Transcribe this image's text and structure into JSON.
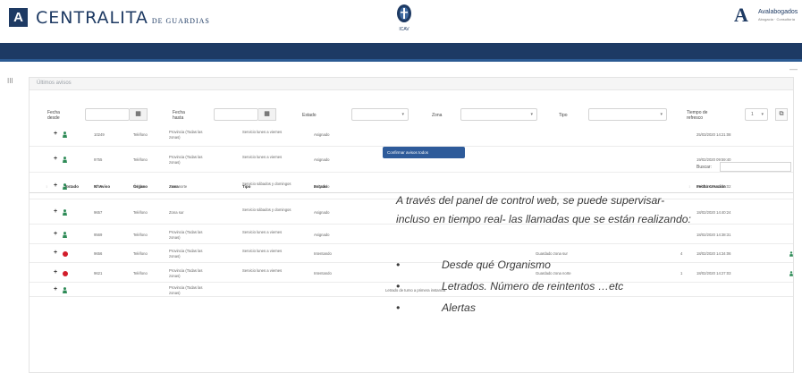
{
  "header": {
    "logo_letter": "A",
    "brand_main": "CENTRALITA",
    "brand_sub": "DE GUARDIAS",
    "emblem_text": "ICAV",
    "right_logo_letter": "A",
    "right_logo_text": "Avalabogados",
    "right_logo_sub": "Abogacía · Consultoría"
  },
  "panel": {
    "title": "Últimos avisos",
    "side_mark": "III",
    "collapse_glyph": "—"
  },
  "filters": {
    "fecha_desde": "Fecha desde",
    "fecha_hasta": "Fecha hasta",
    "estado": "Estado",
    "zona": "Zona",
    "tipo": "Tipo",
    "tiempo_refresco": "Tiempo de refresco",
    "refresh_value": "1",
    "calendar_glyph": "▦",
    "arrow_glyph": "▾",
    "export_glyph": "⧉"
  },
  "actions": {
    "primary_button": "Confirmar avisos todos"
  },
  "search": {
    "label": "Buscar:"
  },
  "table": {
    "columns": [
      "Estado",
      "Nº Aviso",
      "Órgano",
      "Zona",
      "Tipo",
      "Estado",
      "Fecha creación"
    ],
    "sort_glyph": "↕",
    "rows": [
      {
        "status": "ok",
        "num": "10249",
        "organo": "Teléfono",
        "zona": "Provincia (Todas las zonas)",
        "tipo": "Servicio lunes a viernes",
        "estado": "Asignado",
        "extra": "",
        "fecha": "25/03/2020 14:21:08",
        "end_icon": false
      },
      {
        "status": "ok",
        "num": "9755",
        "organo": "Teléfono",
        "zona": "Provincia (Todas las zonas)",
        "tipo": "Servicio lunes a viernes",
        "estado": "Asignado",
        "extra": "",
        "fecha": "19/02/2020 09:59:40",
        "end_icon": false
      },
      {
        "status": "ok",
        "num": "9655",
        "organo": "Teléfono",
        "zona": "Zona norte",
        "tipo": "Servicio sábados y domingos",
        "estado": "Asignado",
        "extra": "",
        "fecha": "18/02/2020 14:44:02",
        "end_icon": false
      },
      {
        "status": "ok",
        "num": "9657",
        "organo": "Teléfono",
        "zona": "Zona sur",
        "tipo": "Servicio sábados y domingos",
        "estado": "Asignado",
        "extra": "",
        "fecha": "18/02/2020 14:40:24",
        "end_icon": false
      },
      {
        "status": "ok",
        "num": "9569",
        "organo": "Teléfono",
        "zona": "Provincia (Todas las zonas)",
        "tipo": "Servicio lunes a viernes",
        "estado": "Asignado",
        "extra": "",
        "fecha": "18/02/2020 14:38:31",
        "end_icon": false
      },
      {
        "status": "alert",
        "num": "9656",
        "organo": "Teléfono",
        "zona": "Provincia (Todas las zonas)",
        "tipo": "Servicio lunes a viernes",
        "estado": "Intentando",
        "extra": "Guardado zona sur",
        "extra_n": "4",
        "fecha": "18/02/2020 14:34:06",
        "end_icon": true
      },
      {
        "status": "alert",
        "num": "9621",
        "organo": "Teléfono",
        "zona": "Provincia (Todas las zonas)",
        "tipo": "Servicio lunes a viernes",
        "estado": "Intentando",
        "extra": "Guardado zona norte",
        "extra_n": "1",
        "fecha": "18/02/2020 14:27:03",
        "end_icon": true
      },
      {
        "status": "ok",
        "num": "",
        "organo": "",
        "zona": "Provincia (Todas las zonas)",
        "tipo": "",
        "estado": "",
        "extra": "Letrado de turno a primera instancia",
        "extra_n": "",
        "fecha": "",
        "end_icon": false
      }
    ]
  },
  "caption": {
    "intro": "A través del panel de control web, se puede supervisar- incluso en tiempo real- las llamadas que se están realizando:",
    "bullet_glyph": "•",
    "bullets": [
      "Desde qué Organismo",
      "Letrados. Número de reintentos …etc",
      "Alertas"
    ]
  },
  "colors": {
    "navy": "#1d3a64",
    "accent_blue": "#2e5b9a",
    "status_ok": "#2e8b57",
    "status_alert": "#d21d2b"
  }
}
